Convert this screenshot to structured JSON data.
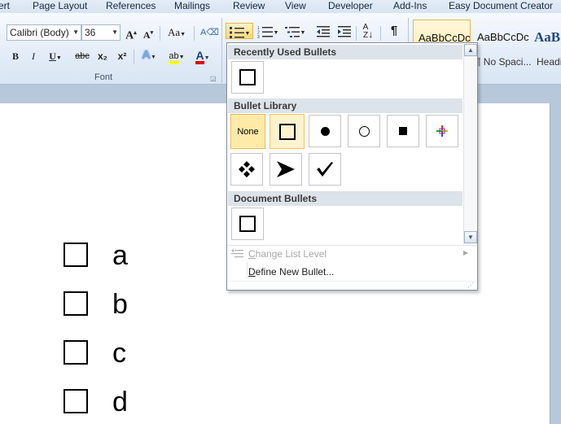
{
  "tabs": [
    {
      "label": "ert"
    },
    {
      "label": "Page Layout"
    },
    {
      "label": "References"
    },
    {
      "label": "Mailings"
    },
    {
      "label": "Review"
    },
    {
      "label": "View"
    },
    {
      "label": "Developer"
    },
    {
      "label": "Add-Ins"
    },
    {
      "label": "Easy Document Creator"
    }
  ],
  "font_group": {
    "font_name": "Calibri (Body)",
    "font_size": "36",
    "label": "Font",
    "grow_label": "A",
    "shrink_label": "A",
    "case_label": "Aa",
    "bold": "B",
    "italic": "I",
    "underline": "U",
    "strike": "abc",
    "subscript": "x₂",
    "superscript": "x²",
    "effects": "A",
    "highlight": "ab",
    "font_color": "A"
  },
  "styles": [
    {
      "sample": "AaBbCcDc",
      "name": ""
    },
    {
      "sample": "AaBbCcDc",
      "name": "¶ No Spaci..."
    },
    {
      "sample": "AaB",
      "name": "Headi"
    }
  ],
  "paragraph": {
    "show_marks": "¶"
  },
  "dropdown": {
    "recently_used": "Recently Used Bullets",
    "library": "Bullet Library",
    "document": "Document Bullets",
    "none_label": "None",
    "change_level": "Change List Level",
    "change_level_underline": "C",
    "define_new": "Define New Bullet...",
    "define_new_underline": "D"
  },
  "document": {
    "items": [
      "a",
      "b",
      "c",
      "d"
    ]
  },
  "colors": {
    "highlight": "#ffff00",
    "font_color": "#e00000",
    "selected_cell": "#ffeaa7",
    "selected_border": "#e7b540"
  },
  "icons": {
    "library": [
      "none",
      "hollow-square",
      "filled-circle",
      "hollow-circle",
      "filled-square",
      "colored-crosshair",
      "four-diamonds",
      "arrowhead",
      "check-mark"
    ]
  }
}
